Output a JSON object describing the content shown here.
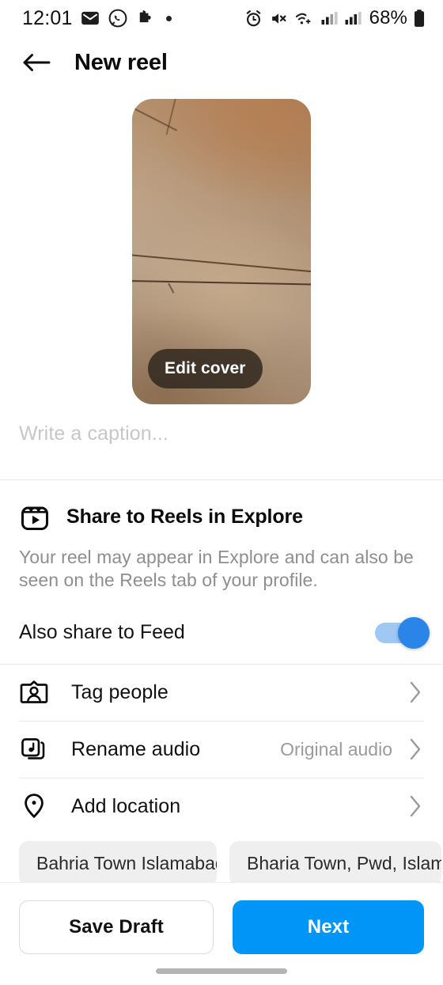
{
  "status_bar": {
    "time": "12:01",
    "left_icons": [
      "mail-icon",
      "whatsapp-icon",
      "puzzle-icon",
      "dot-icon"
    ],
    "right_icons": [
      "alarm-icon",
      "mute-icon",
      "wifi-icon",
      "signal-icon-1",
      "signal-icon-2"
    ],
    "battery": "68%"
  },
  "header": {
    "back_icon": "back-arrow-icon",
    "title": "New reel"
  },
  "cover": {
    "edit_cover_label": "Edit cover"
  },
  "caption": {
    "placeholder": "Write a caption...",
    "value": ""
  },
  "explore": {
    "icon": "reels-icon",
    "title": "Share to Reels in Explore",
    "description": "Your reel may appear in Explore and can also be seen on the Reels tab of your profile."
  },
  "feed_toggle": {
    "label": "Also share to Feed",
    "state": "on",
    "track_color": "#9fc9f3",
    "knob_color": "#2b85e9"
  },
  "options": [
    {
      "icon": "tag-people-icon",
      "label": "Tag people",
      "value": "",
      "chevron": "chevron-right-icon"
    },
    {
      "icon": "audio-icon",
      "label": "Rename audio",
      "value": "Original audio",
      "chevron": "chevron-right-icon"
    },
    {
      "icon": "location-pin-icon",
      "label": "Add location",
      "value": "",
      "chevron": "chevron-right-icon"
    }
  ],
  "location_suggestions": [
    "Bahria Town Islamabad",
    "Bharia Town, Pwd, Islama..."
  ],
  "bottom_bar": {
    "save_draft_label": "Save Draft",
    "next_label": "Next",
    "next_color": "#0095f6"
  }
}
